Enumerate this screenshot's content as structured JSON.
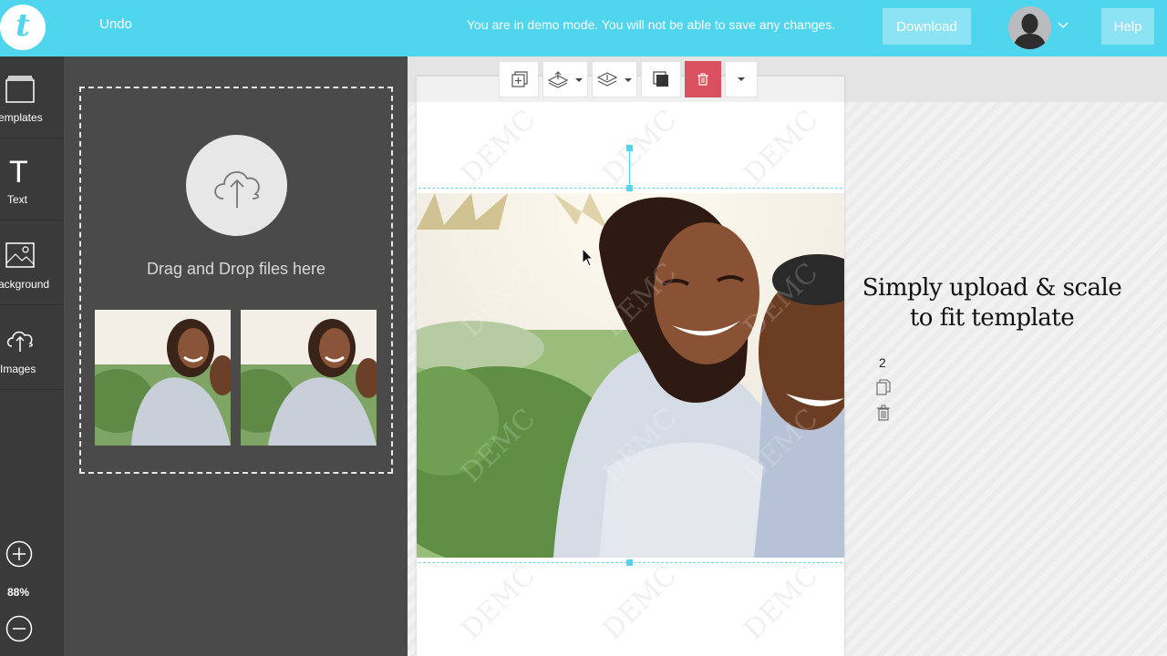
{
  "topbar": {
    "logo_letter": "t",
    "undo_label": "Undo",
    "demo_message": "You are in demo mode. You will not be able to save any changes.",
    "download_label": "Download",
    "help_label": "Help",
    "avatar_icon": "user-avatar-icon",
    "accent_color": "#4fd5ee"
  },
  "rail": {
    "items": [
      {
        "label": "emplates",
        "icon": "templates-icon"
      },
      {
        "label": "Text",
        "icon": "text-icon"
      },
      {
        "label": "ackground",
        "icon": "background-icon"
      },
      {
        "label": "Images",
        "icon": "upload-cloud-icon"
      }
    ],
    "zoom_level": "88%"
  },
  "upload_panel": {
    "drop_text": "Drag and Drop files here",
    "thumbnails": [
      "couple-photo-thumbnail",
      "couple-photo-thumbnail"
    ]
  },
  "toolbar": {
    "buttons": [
      "add-page-icon",
      "layer-up-icon",
      "layer-down-icon",
      "snap-icon",
      "delete-icon",
      "more-options-icon"
    ],
    "delete_color": "#d9505e"
  },
  "canvas": {
    "watermark": "DEMC"
  },
  "side_info": {
    "caption": "Simply upload & scale to fit template",
    "page_number": "2"
  }
}
